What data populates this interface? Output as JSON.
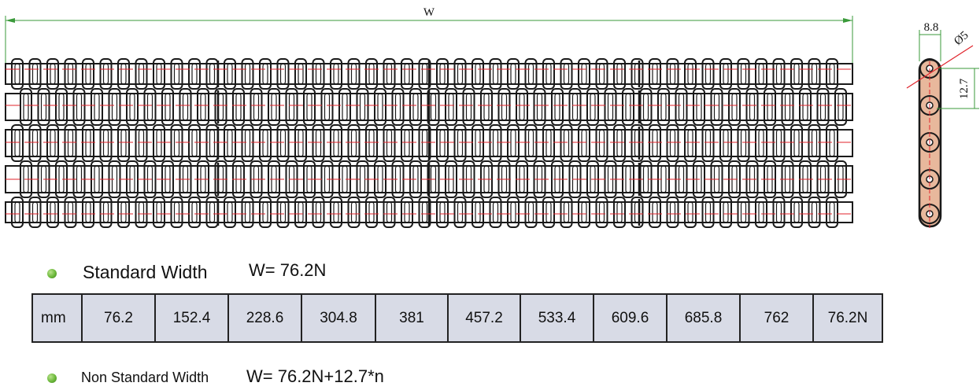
{
  "drawing": {
    "width_label": "W",
    "side_view": {
      "dim_width": "8.8",
      "dim_pitch": "12.7",
      "dim_hole": "Ø5"
    }
  },
  "standard_width": {
    "label": "Standard Width",
    "formula": "W=  76.2N"
  },
  "table": {
    "unit": "mm",
    "values": [
      "76.2",
      "152.4",
      "228.6",
      "304.8",
      "381",
      "457.2",
      "533.4",
      "609.6",
      "685.8",
      "762",
      "76.2N"
    ]
  },
  "non_standard_width": {
    "label": "Non Standard Width",
    "formula": "W=  76.2N+12.7*n"
  },
  "colors": {
    "outline": "#1a1a1a",
    "center_line": "#e0232b",
    "dimension": "#3a9a3a",
    "table_bg": "#d8dbe6",
    "link_fill": "#e8b89c"
  }
}
